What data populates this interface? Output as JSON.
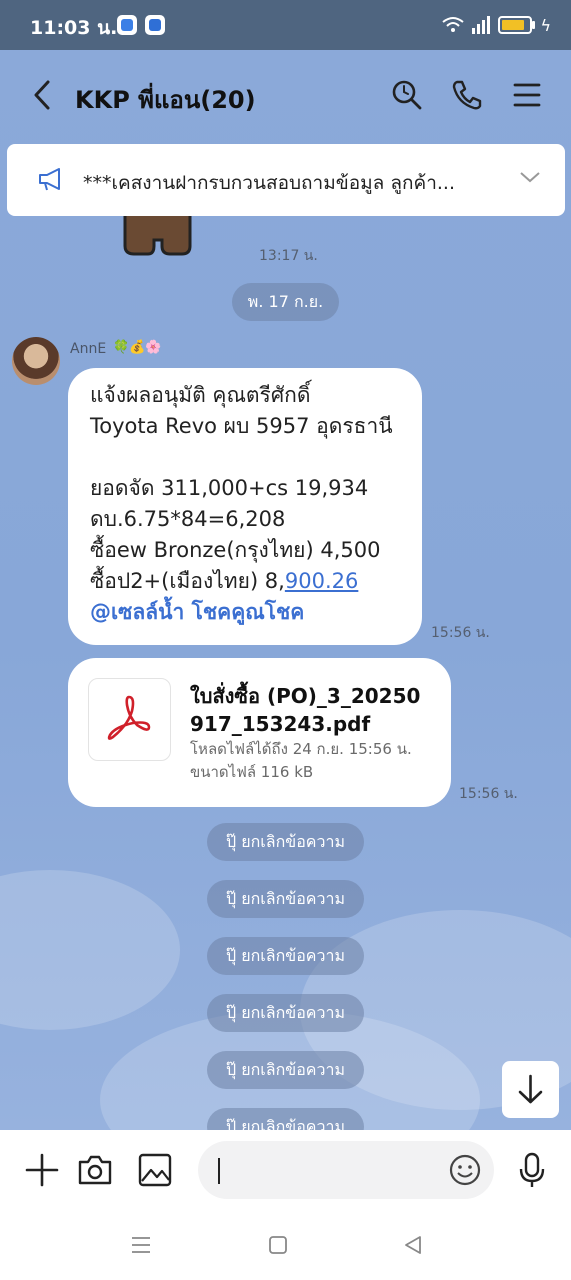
{
  "status_bar": {
    "time": "11:03 น.",
    "battery_color": "#f2c025"
  },
  "header": {
    "title": "KKP พี่แอน(20)",
    "icons": [
      "back-arrow-icon",
      "search-icon",
      "phone-icon",
      "menu-icon"
    ]
  },
  "notice": {
    "text": "***เคสงานฝากรบกวนสอบถามข้อมูล ลูกค้า..."
  },
  "messages": {
    "sticker_time": "13:17 น.",
    "date_label": "พ. 17 ก.ย.",
    "sender_name": "AnnE",
    "sender_emoji": "🍀💰🌸",
    "text_lines": [
      "แจ้งผลอนุมัติ คุณตรีศักดิ์",
      "Toyota Revo ผบ 5957 อุดรธานี",
      "",
      "ยอดจัด 311,000+cs 19,934",
      "ดบ.6.75*84=6,208",
      "ซื้อew Bronze(กรุงไทย) 4,500"
    ],
    "last_line_prefix": "ซื้อป2+(เมืองไทย) 8,",
    "last_line_link": "900.26",
    "mention": "@เซลล์น้ำ โชคคูณโชค",
    "text_time": "15:56 น.",
    "file_name_line1": "ใบสั่งซื้อ (PO)_3_20250",
    "file_name_line2": "917_153243.pdf",
    "file_expiry": "โหลดไฟล์ได้ถึง 24 ก.ย. 15:56 น.",
    "file_size": "ขนาดไฟล์ 116 kB",
    "file_time": "15:56 น.",
    "unsent_label": "ปุ๊ ยกเลิกข้อความ"
  },
  "composer": {
    "input_value": "",
    "icons": [
      "plus-icon",
      "camera-icon",
      "image-icon",
      "emoji-icon",
      "microphone-icon"
    ]
  },
  "accent_color": "#3b6fd1"
}
